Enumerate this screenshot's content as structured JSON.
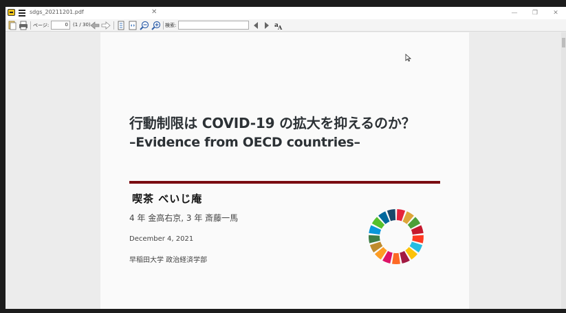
{
  "window": {
    "tab_title": "sdgs_20211201.pdf",
    "tab_close": "✕",
    "minimize": "—",
    "restore": "❐",
    "close": "✕"
  },
  "toolbar": {
    "page_label": "ページ:",
    "page_value": "0",
    "page_total": "(1 / 30)",
    "search_label": "検索:",
    "search_value": ""
  },
  "document": {
    "title_line1": "行動制限は COVID-19 の拡大を抑えるのか？",
    "title_line2": "–Evidence from OECD countries–",
    "team_name": "喫茶 べいじ庵",
    "authors": "4 年 金高右京, 3 年 斎藤一馬",
    "date": "December 4, 2021",
    "affiliation": "早稲田大学 政治経済学部",
    "rule_color": "#7a0b10"
  },
  "sdg_colors": [
    "#e5243b",
    "#dda63a",
    "#4c9f38",
    "#c5192d",
    "#ff3a21",
    "#26bde2",
    "#fcc30b",
    "#a21942",
    "#fd6925",
    "#dd1367",
    "#fd9d24",
    "#bf8b2e",
    "#3f7e44",
    "#0a97d9",
    "#56c02b",
    "#00689d",
    "#19486a"
  ]
}
